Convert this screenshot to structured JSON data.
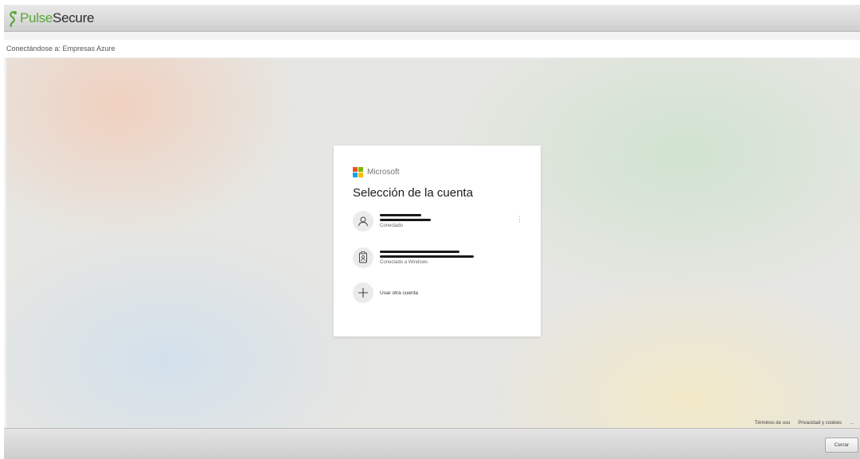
{
  "app": {
    "brand_part1": "Pulse",
    "brand_part2": "Secure",
    "brand_color": "#5aa83a"
  },
  "status_text": "Conectándose a: Empresas Azure",
  "dialog": {
    "provider": "Microsoft",
    "title": "Selección de la cuenta",
    "accounts": [
      {
        "icon": "person-icon",
        "status": "Conectado"
      },
      {
        "icon": "work-badge-icon",
        "status": "Conectado a Windows"
      }
    ],
    "other_account_label": "Usar otra cuenta",
    "more_options": "⋮"
  },
  "footer": {
    "terms": "Términos de uso",
    "privacy": "Privacidad y cookies",
    "more": "..."
  },
  "buttons": {
    "close_label": "Cerrar"
  },
  "colors": {
    "ms_red": "#f25022",
    "ms_green": "#7fba00",
    "ms_blue": "#00a4ef",
    "ms_yellow": "#ffb900"
  }
}
